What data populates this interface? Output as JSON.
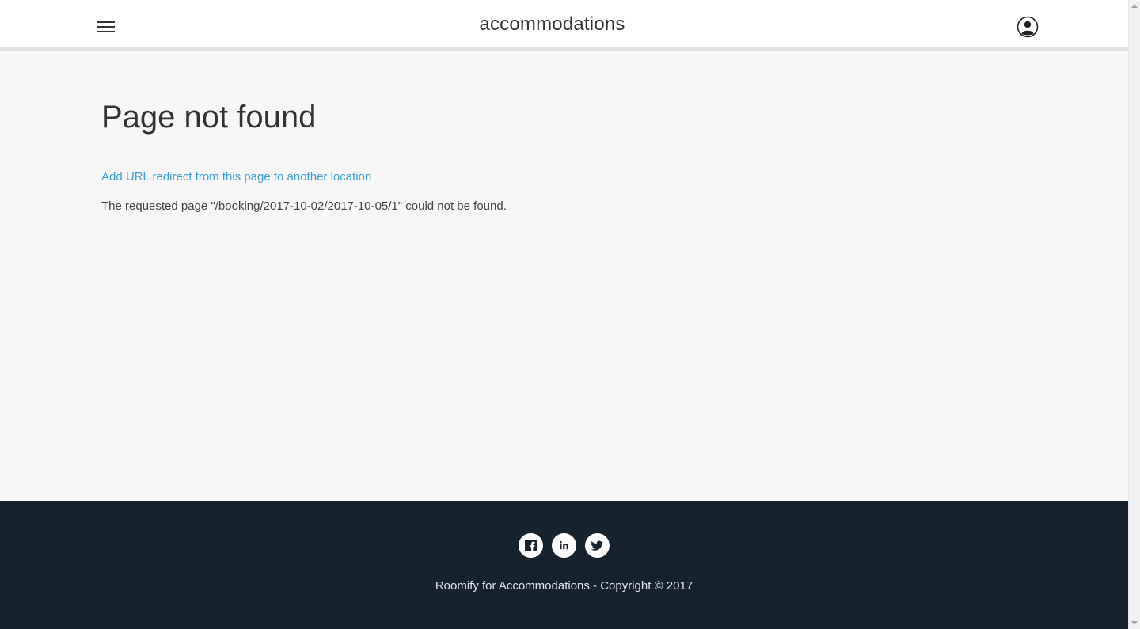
{
  "header": {
    "site_title": "accommodations",
    "menu_icon": "hamburger-menu-icon",
    "user_icon": "user-account-icon"
  },
  "main": {
    "title": "Page not found",
    "redirect_link": "Add URL redirect from this page to another location",
    "message": "The requested page \"/booking/2017-10-02/2017-10-05/1\" could not be found."
  },
  "footer": {
    "socials": [
      "facebook-icon",
      "linkedin-icon",
      "twitter-icon"
    ],
    "copyright": "Roomify for Accommodations - Copyright © 2017"
  },
  "colors": {
    "link": "#3a9fd6",
    "footer_bg": "#16232e",
    "page_bg": "#f7f7f7"
  }
}
